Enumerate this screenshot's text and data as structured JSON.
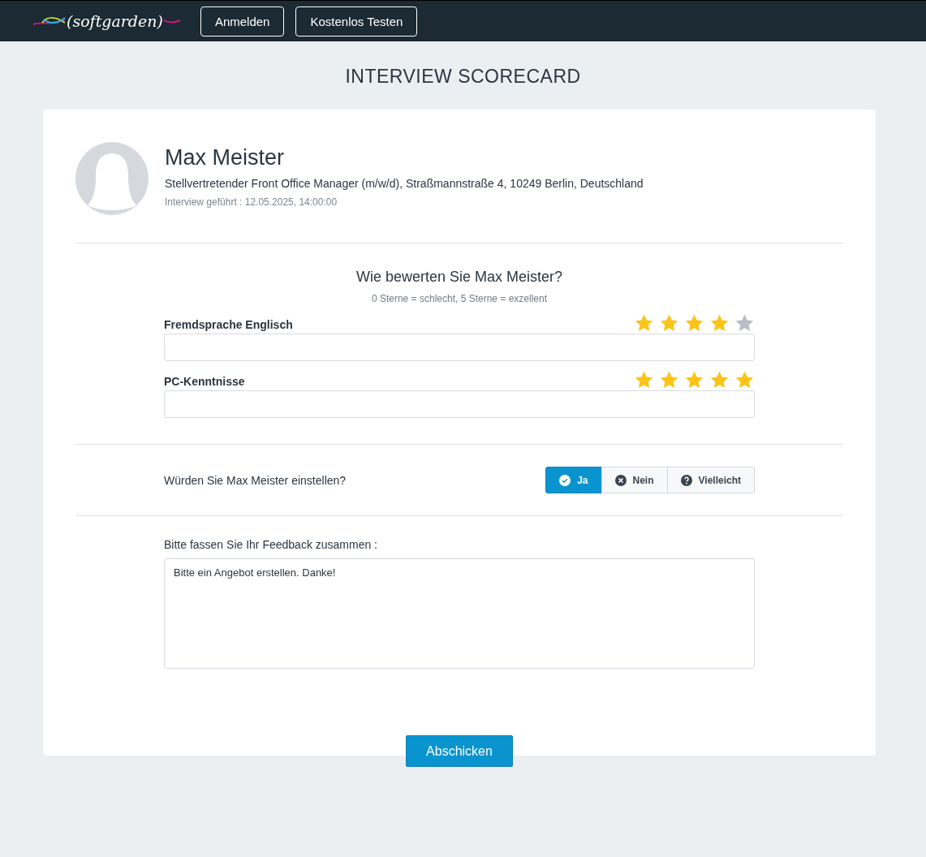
{
  "header": {
    "logo": "(softgarden)",
    "buttons": [
      "Anmelden",
      "Kostenlos Testen"
    ]
  },
  "title": "INTERVIEW SCORECARD",
  "candidate": {
    "name": "Max Meister",
    "position": "Stellvertretender Front Office Manager (m/w/d), Straßmannstraße 4, 10249 Berlin, Deutschland",
    "interview": "Interview geführt : 12.05.2025, 14:00:00"
  },
  "rating": {
    "question": "Wie bewerten Sie Max Meister?",
    "hint": "0 Sterne = schlecht, 5 Sterne = exzellent",
    "criteria": [
      {
        "label": "Fremdsprache Englisch",
        "stars": 4
      },
      {
        "label": "PC-Kenntnisse",
        "stars": 5
      }
    ]
  },
  "hire": {
    "question": "Würden Sie Max Meister einstellen?",
    "options": [
      {
        "label": "Ja",
        "kind": "yes",
        "selected": true
      },
      {
        "label": "Nein",
        "kind": "no",
        "selected": false
      },
      {
        "label": "Vielleicht",
        "kind": "maybe",
        "selected": false
      }
    ]
  },
  "feedback": {
    "label": "Bitte fassen Sie Ihr Feedback zusammen :",
    "value": "Bitte ein Angebot erstellen. Danke!"
  },
  "submit": "Abschicken"
}
